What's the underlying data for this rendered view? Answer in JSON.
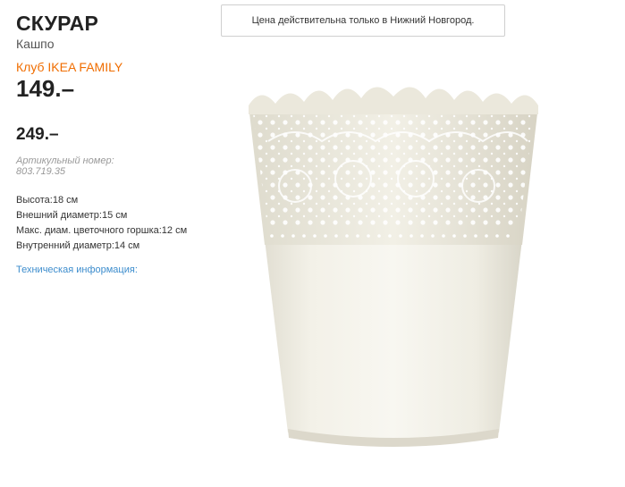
{
  "product": {
    "name": "СКУРАР",
    "type": "Кашпо",
    "club_label": "Клуб IKEA FAMILY",
    "family_price": "149.–",
    "regular_price": "249.–",
    "article_label": "Артикульный номер: 803.719.35"
  },
  "specs": [
    "Высота:18 см",
    "Внешний диаметр:15 см",
    "Макс. диам. цветочного горшка:12 см",
    "Внутренний диаметр:14 см"
  ],
  "links": {
    "tech_info": "Техническая информация:"
  },
  "notice": {
    "text": "Цена действительна только в Нижний Новгород."
  },
  "colors": {
    "club_accent": "#f06d00",
    "link": "#3d8dcd",
    "pot": "#f3f1e7"
  },
  "image": {
    "icon": "flower-pot-image"
  }
}
